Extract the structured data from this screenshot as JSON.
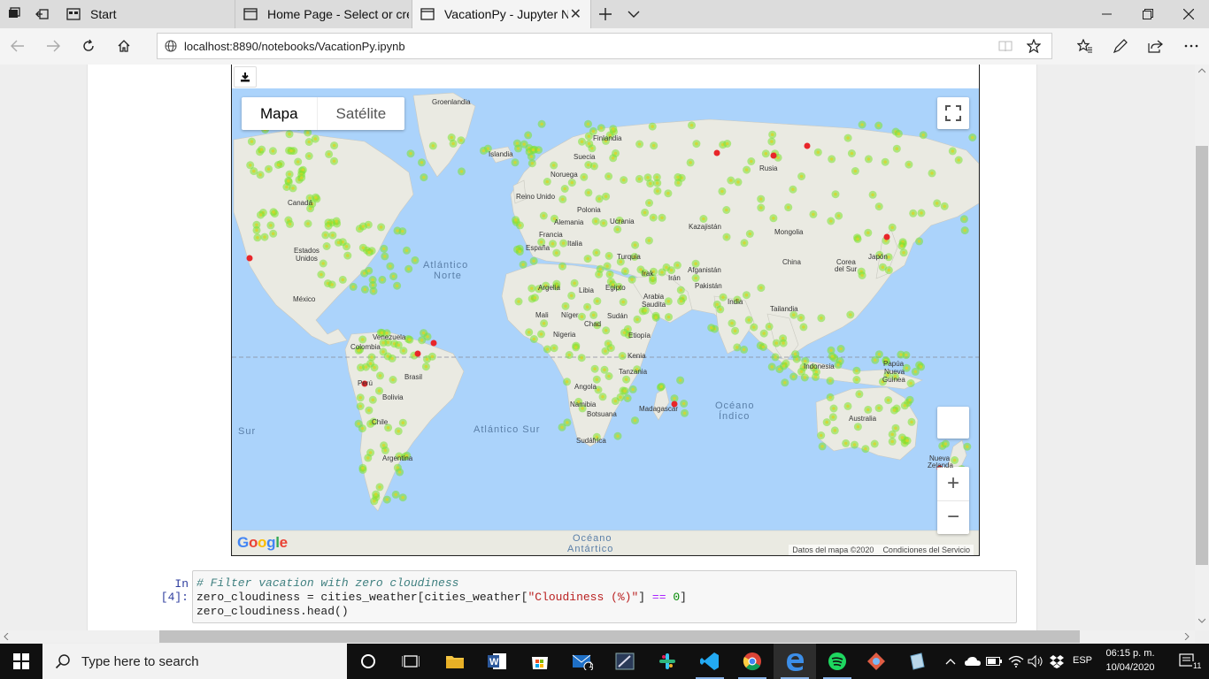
{
  "browser": {
    "tabs": [
      {
        "title": "Start",
        "active": false
      },
      {
        "title": "Home Page - Select or creat",
        "active": false
      },
      {
        "title": "VacationPy - Jupyter Nc",
        "active": true
      }
    ],
    "url": "localhost:8890/notebooks/VacationPy.ipynb"
  },
  "map": {
    "type_buttons": {
      "map": "Mapa",
      "satellite": "Satélite"
    },
    "attribution": {
      "data": "Datos del mapa ©2020",
      "terms": "Condiciones del Servicio"
    },
    "logo": "Google",
    "zoom_in": "+",
    "zoom_out": "−",
    "labels": {
      "groenlandia": "Groenlandia",
      "islandia": "Islandia",
      "finlandia": "Finlandia",
      "suecia": "Suecia",
      "noruega": "Noruega",
      "rusia": "Rusia",
      "reino_unido": "Reino Unido",
      "polonia": "Polonia",
      "alemania": "Alemania",
      "ucrania": "Ucrania",
      "francia": "Francia",
      "italia": "Italia",
      "espana": "España",
      "kazajistan": "Kazajistán",
      "mongolia": "Mongolia",
      "canada": "Canadá",
      "estados_unidos_1": "Estados",
      "estados_unidos_2": "Unidos",
      "mexico": "México",
      "turquia": "Turquia",
      "irak": "Irak",
      "iran": "Irán",
      "afganistan": "Afganistán",
      "pakistan": "Pakistán",
      "china": "China",
      "corea_1": "Corea",
      "corea_2": "del Sur",
      "japon": "Japón",
      "argelia": "Argelia",
      "libia": "Libia",
      "egipto": "Egipto",
      "arabia_1": "Arabia",
      "arabia_2": "Saudita",
      "india": "India",
      "mali": "Mali",
      "niger": "Níger",
      "chad": "Chad",
      "sudan": "Sudán",
      "tailandia": "Tailandia",
      "nigeria": "Nigeria",
      "etiopia": "Etiopía",
      "venezuela": "Venezuela",
      "colombia": "Colombia",
      "kenia": "Kenia",
      "indonesia": "Indonesia",
      "tanzania": "Tanzania",
      "papua_1": "Papúa",
      "papua_2": "Nueva",
      "papua_3": "Guinea",
      "peru": "Perú",
      "brasil": "Brasil",
      "angola": "Angola",
      "bolivia": "Bolivia",
      "namibia": "Namibia",
      "botsuana": "Botsuana",
      "madagascar": "Madagascar",
      "australia": "Australia",
      "chile": "Chile",
      "sudafrica": "Sudáfrica",
      "argentina": "Argentina",
      "nueva_zelanda_1": "Nueva",
      "nueva_zelanda_2": "Zelanda"
    },
    "oceans": {
      "atl_norte_1": "Atlántico",
      "atl_norte_2": "Norte",
      "indico_1": "Océano",
      "indico_2": "Índico",
      "atl_sur": "Atlántico Sur",
      "pac_sur": "Sur",
      "antartico_1": "Océano",
      "antartico_2": "Antártico"
    }
  },
  "cell": {
    "prompt": "In [4]:",
    "line1_comment": "# Filter vacation with zero cloudiness",
    "line2_a": "zero_cloudiness = cities_weather[cities_weather[",
    "line2_string": "\"Cloudiness (%)\"",
    "line2_b": "] ",
    "line2_op": "==",
    "line2_sp": " ",
    "line2_num": "0",
    "line2_c": "]",
    "line3": "zero_cloudiness.head()"
  },
  "taskbar": {
    "search_placeholder": "Type here to search",
    "language": "ESP",
    "time": "06:15 p. m.",
    "date": "10/04/2020",
    "notifications": "11",
    "mail_badge": "1"
  },
  "colors": {
    "land": "#eaeae2",
    "water": "#abd3fb",
    "heat_low": "#7ce12e",
    "heat_high": "#e8262a",
    "prompt": "#303f9f"
  }
}
